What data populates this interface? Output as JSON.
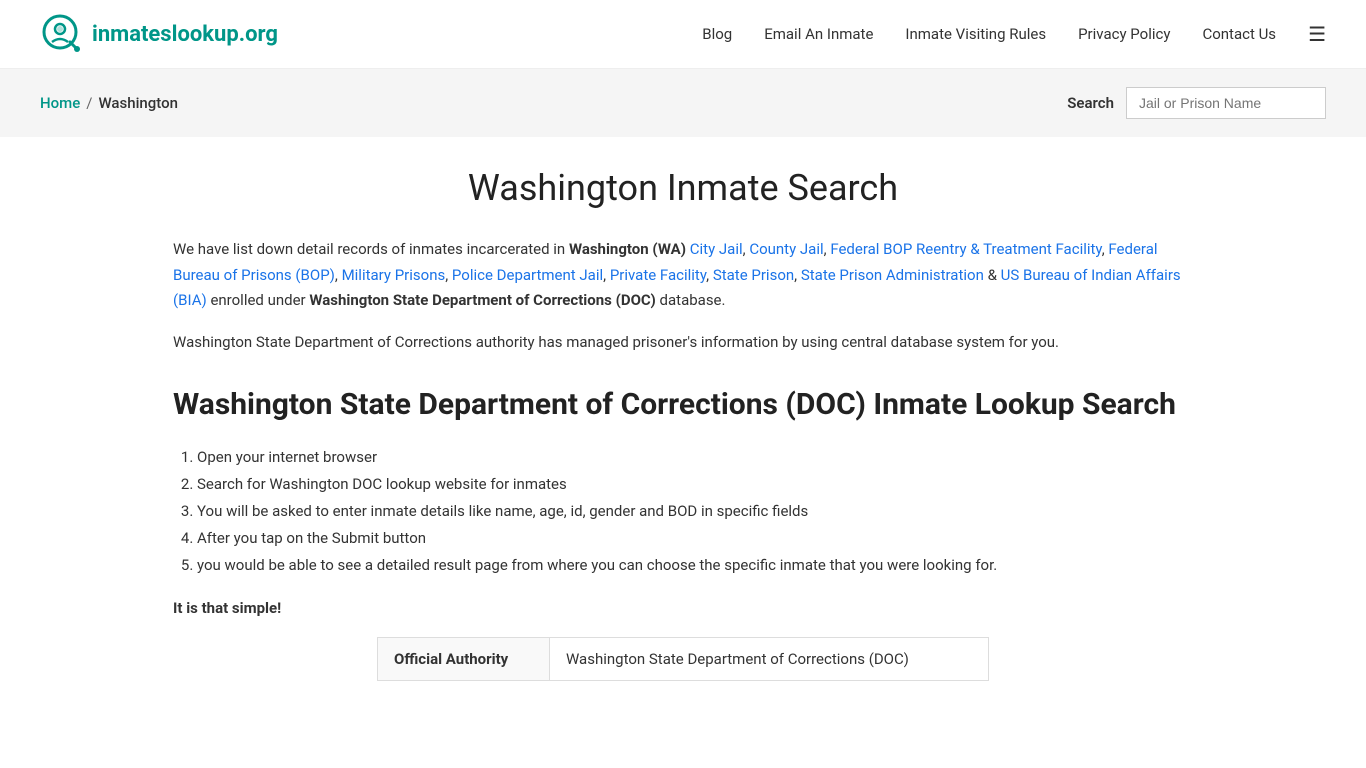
{
  "header": {
    "logo_text_plain": "inmates",
    "logo_text_bold": "lookup.org",
    "nav": {
      "blog": "Blog",
      "email_inmate": "Email An Inmate",
      "visiting_rules": "Inmate Visiting Rules",
      "privacy_policy": "Privacy Policy",
      "contact_us": "Contact Us"
    }
  },
  "breadcrumb": {
    "home": "Home",
    "separator": "/",
    "current": "Washington"
  },
  "search": {
    "label": "Search",
    "placeholder": "Jail or Prison Name"
  },
  "page": {
    "title": "Washington Inmate Search",
    "intro": {
      "prefix": "We have list down detail records of inmates incarcerated in ",
      "state_bold": "Washington (WA)",
      "links": [
        "City Jail",
        "County Jail",
        "Federal BOP Reentry & Treatment Facility",
        "Federal Bureau of Prisons (BOP)",
        "Military Prisons",
        "Police Department Jail",
        "Private Facility",
        "State Prison",
        "State Prison Administration",
        "US Bureau of Indian Affairs (BIA)"
      ],
      "suffix_pre": "enrolled under ",
      "suffix_bold": "Washington State Department of Corrections (DOC)",
      "suffix_post": " database."
    },
    "authority_text": "Washington State Department of Corrections authority has managed prisoner's information by using central database system for you.",
    "section_title": "Washington State Department of Corrections (DOC) Inmate Lookup Search",
    "steps": [
      "Open your internet browser",
      "Search for Washington DOC lookup website for inmates",
      "You will be asked to enter inmate details like name, age, id, gender and BOD in specific fields",
      "After you tap on the Submit button",
      "you would be able to see a detailed result page from where you can choose the specific inmate that you were looking for."
    ],
    "simple_text": "It is that simple!",
    "table": {
      "col1_header": "Official Authority",
      "col1_value": "Washington State Department of Corrections (DOC)"
    }
  }
}
